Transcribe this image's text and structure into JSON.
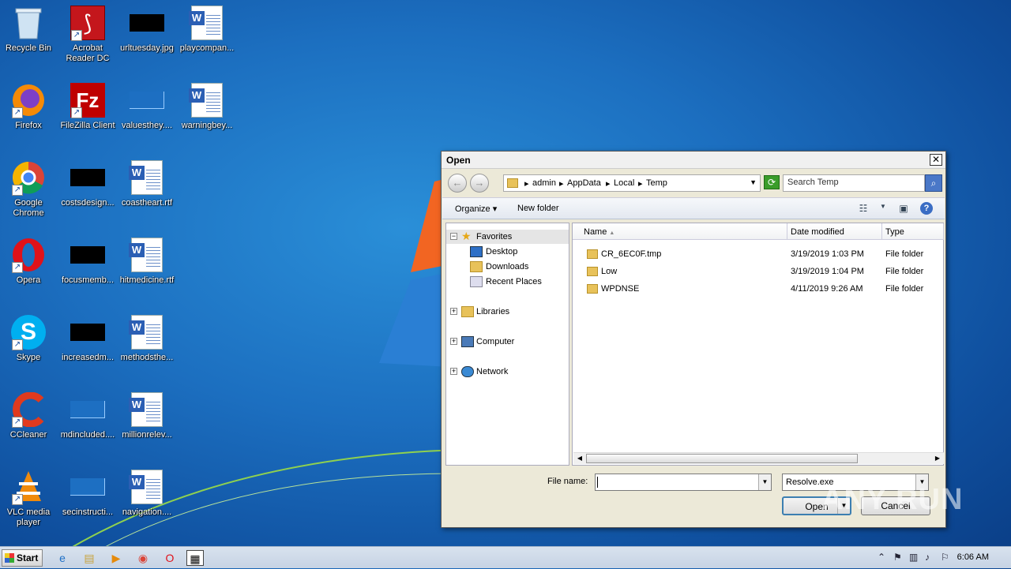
{
  "desktop": {
    "icons": [
      {
        "label": "Recycle Bin",
        "icon": "recycle-bin-icon"
      },
      {
        "label": "Acrobat Reader DC",
        "icon": "acrobat-icon"
      },
      {
        "label": "urltuesday.jpg",
        "icon": "image-file-icon"
      },
      {
        "label": "playcompan...",
        "icon": "word-doc-icon"
      },
      {
        "label": "Firefox",
        "icon": "firefox-icon"
      },
      {
        "label": "FileZilla Client",
        "icon": "filezilla-icon"
      },
      {
        "label": "valuesthey....",
        "icon": "file-icon"
      },
      {
        "label": "warningbey...",
        "icon": "word-doc-icon"
      },
      {
        "label": "Google Chrome",
        "icon": "chrome-icon"
      },
      {
        "label": "costsdesign...",
        "icon": "image-file-icon"
      },
      {
        "label": "coastheart.rtf",
        "icon": "word-doc-icon"
      },
      {
        "label": "Opera",
        "icon": "opera-icon"
      },
      {
        "label": "focusmemb...",
        "icon": "image-file-icon"
      },
      {
        "label": "hitmedicine.rtf",
        "icon": "word-doc-icon"
      },
      {
        "label": "Skype",
        "icon": "skype-icon"
      },
      {
        "label": "increasedm...",
        "icon": "image-file-icon"
      },
      {
        "label": "methodsthe...",
        "icon": "word-doc-icon"
      },
      {
        "label": "CCleaner",
        "icon": "ccleaner-icon"
      },
      {
        "label": "mdincluded....",
        "icon": "file-icon"
      },
      {
        "label": "millionrelev...",
        "icon": "word-doc-icon"
      },
      {
        "label": "VLC media player",
        "icon": "vlc-icon"
      },
      {
        "label": "secinstructi...",
        "icon": "file-icon"
      },
      {
        "label": "navigation....",
        "icon": "word-doc-icon"
      }
    ]
  },
  "dialog": {
    "title": "Open",
    "breadcrumb": [
      "admin",
      "AppData",
      "Local",
      "Temp"
    ],
    "search_placeholder": "Search Temp",
    "toolbar": {
      "organize": "Organize",
      "new_folder": "New folder"
    },
    "nav": {
      "favorites": "Favorites",
      "desktop": "Desktop",
      "downloads": "Downloads",
      "recent": "Recent Places",
      "libraries": "Libraries",
      "computer": "Computer",
      "network": "Network"
    },
    "columns": {
      "name": "Name",
      "date": "Date modified",
      "type": "Type"
    },
    "files": [
      {
        "name": "CR_6EC0F.tmp",
        "date": "3/19/2019 1:03 PM",
        "type": "File folder"
      },
      {
        "name": "Low",
        "date": "3/19/2019 1:04 PM",
        "type": "File folder"
      },
      {
        "name": "WPDNSE",
        "date": "4/11/2019 9:26 AM",
        "type": "File folder"
      }
    ],
    "file_name_label": "File name:",
    "file_name_value": "",
    "filter": "Resolve.exe",
    "open_label": "Open",
    "cancel_label": "Cancel"
  },
  "watermark": "ANY RUN",
  "taskbar": {
    "start": "Start",
    "clock": "6:06 AM"
  }
}
